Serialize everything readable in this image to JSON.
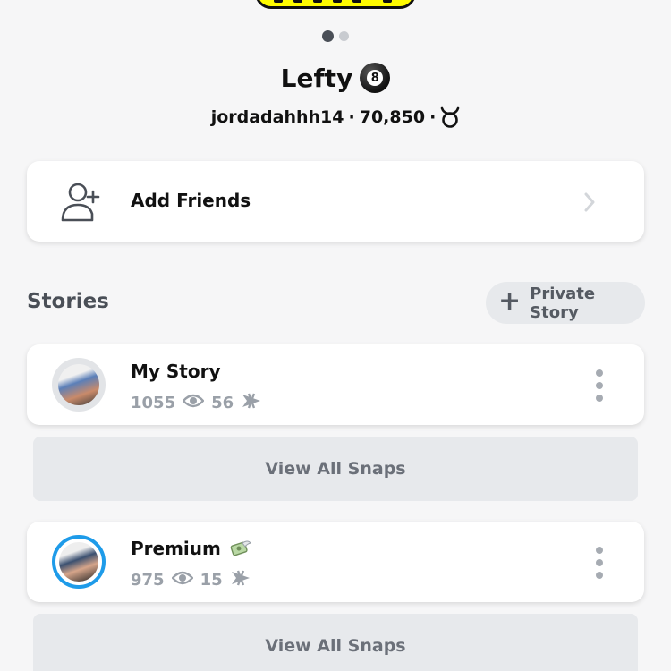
{
  "profile": {
    "display_name": "Lefty",
    "ball_number": "8",
    "username": "jordadahhh14",
    "separator": "·",
    "score": "70,850"
  },
  "add_friends": {
    "label": "Add Friends"
  },
  "stories": {
    "section_title": "Stories",
    "private_story_label": "Private Story",
    "items": [
      {
        "title": "My Story",
        "views": "1055",
        "screenshots": "56",
        "view_all_label": "View All Snaps"
      },
      {
        "title": "Premium",
        "views": "975",
        "screenshots": "15",
        "view_all_label": "View All Snaps"
      }
    ]
  },
  "colors": {
    "background": "#f6f6f7",
    "snap_yellow": "#fffc00",
    "ring_blue": "#1e9be9",
    "muted_text": "#9aa0a8"
  },
  "icons": {
    "add_friends": "add-friend-icon",
    "views": "eye-icon",
    "screenshots": "screenshot-arrow-icon",
    "zodiac": "taurus-icon",
    "menu": "more-vertical-icon"
  }
}
